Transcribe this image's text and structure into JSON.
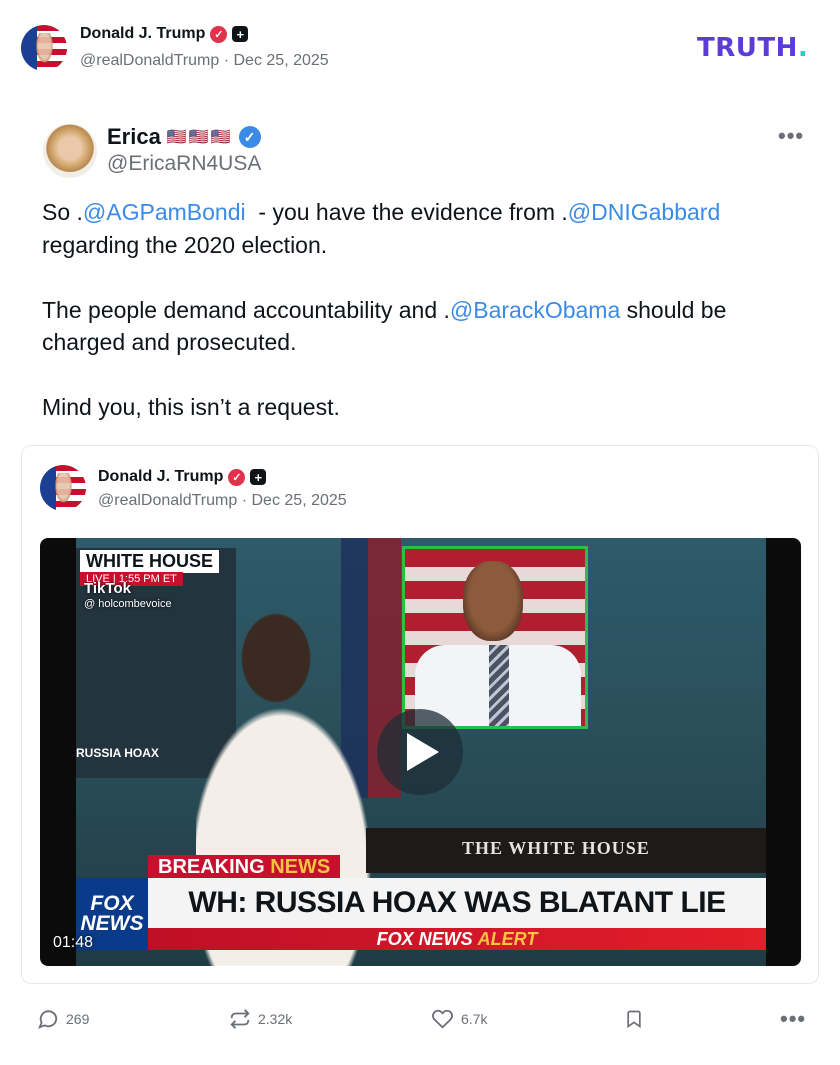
{
  "header": {
    "author_name": "Donald J. Trump",
    "author_handle": "@realDonaldTrump",
    "separator": "·",
    "date": "Dec 25, 2025",
    "logo_text": "TRUTH",
    "logo_dot": ".",
    "brand_color": "#5b3cd6"
  },
  "post": {
    "author_name": "Erica",
    "flags": "🇺🇸🇺🇸🇺🇸",
    "author_handle": "@EricaRN4USA",
    "more_label": "•••",
    "lines": {
      "l1_a": "So .",
      "l1_m1": "@AGPamBondi",
      "l1_b": "  - you have the evidence from .",
      "l1_m2": "@DNIGabbard",
      "l1_c": "regarding the 2020 election.",
      "l2_a": "The people demand accountability and .",
      "l2_m": "@BarackObama",
      "l2_b": " should be charged and prosecuted.",
      "l3": "Mind you, this isn’t a request."
    }
  },
  "quote": {
    "author_name": "Donald J. Trump",
    "author_handle": "@realDonaldTrump",
    "separator": "·",
    "date": "Dec 25, 2025",
    "video": {
      "duration": "01:48",
      "wh_banner": "WHITE HOUSE",
      "live_bar": "LIVE | 1:55 PM ET",
      "tiktok": "TikTok",
      "tiktok_user": "@ holcombevoice",
      "russia_tag": "RUSSIA HOAX",
      "podium_text": "THE WHITE HOUSE",
      "breaking_1": "BREAKING",
      "breaking_2": "NEWS",
      "headline": "WH: RUSSIA HOAX WAS BLATANT LIE",
      "alert_1": "FOX NEWS",
      "alert_2": "ALERT",
      "fox_logo_1": "FOX",
      "fox_logo_2": "NEWS"
    }
  },
  "actions": {
    "replies": "269",
    "retruths": "2.32k",
    "likes": "6.7k",
    "more_label": "•••"
  }
}
